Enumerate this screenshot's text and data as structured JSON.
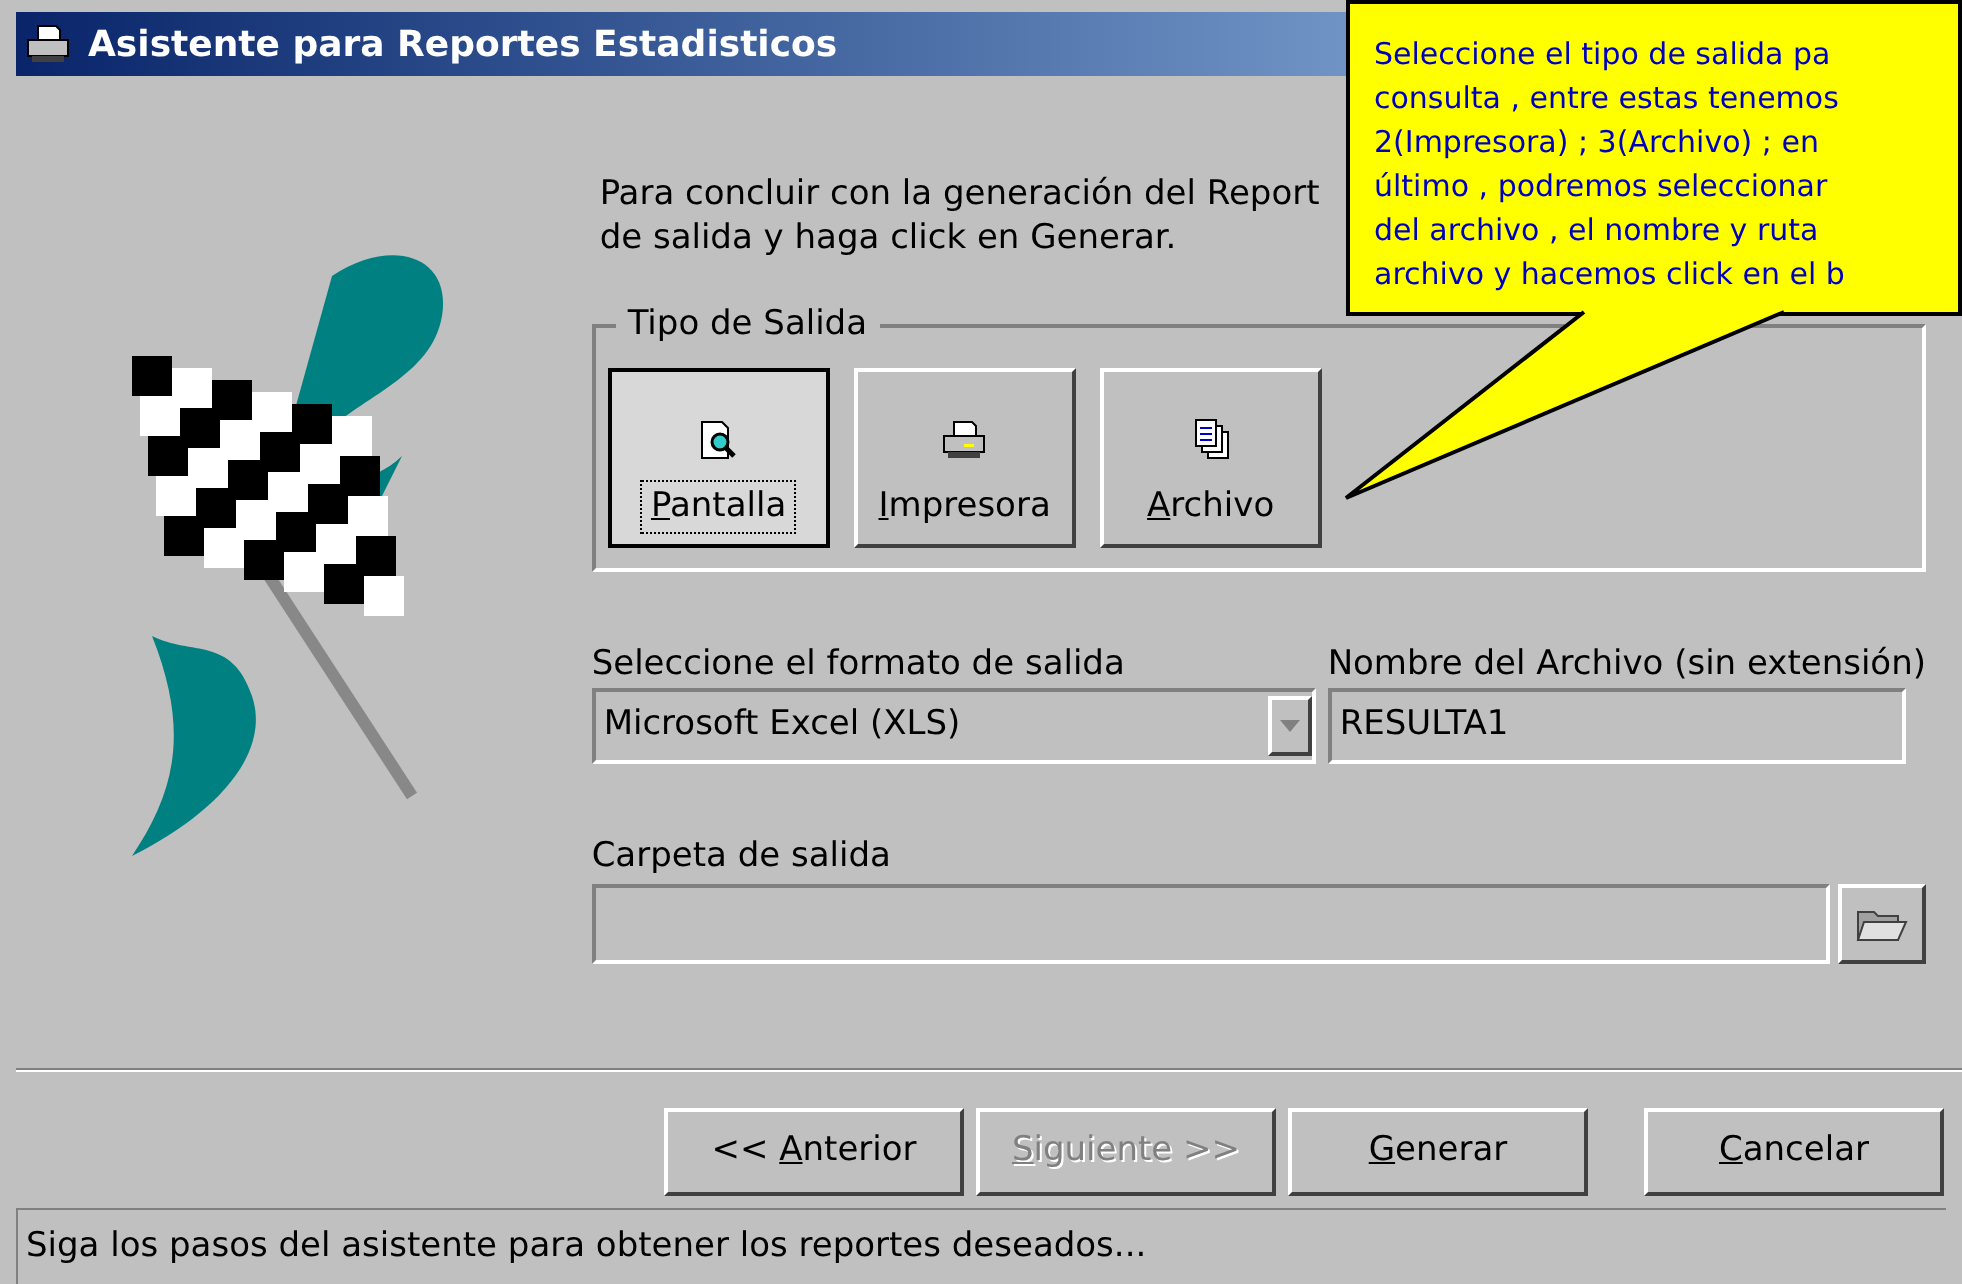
{
  "window": {
    "title": "Asistente para Reportes Estadisticos"
  },
  "intro": [
    "Para concluir con la generación del Report",
    "de salida y haga click en Generar."
  ],
  "output_type": {
    "title": "Tipo de Salida",
    "options": [
      {
        "label": {
          "key": "P",
          "after": "antalla"
        },
        "selected": true,
        "kind": "screen"
      },
      {
        "label": {
          "key": "I",
          "after": "mpresora"
        },
        "selected": false,
        "kind": "printer"
      },
      {
        "label": {
          "key": "A",
          "after": "rchivo"
        },
        "selected": false,
        "kind": "file"
      }
    ]
  },
  "format": {
    "label": "Seleccione el formato de salida",
    "value": "Microsoft Excel (XLS)"
  },
  "file_name": {
    "label": "Nombre del Archivo (sin extensión)",
    "value": "RESULTA1"
  },
  "folder": {
    "label": "Carpeta de salida"
  },
  "buttons": [
    {
      "label": {
        "before": "<< ",
        "key": "A",
        "after": "nterior"
      },
      "disabled": false
    },
    {
      "label": {
        "key": "S",
        "after": "iguiente >>"
      },
      "disabled": true
    },
    {
      "label": {
        "key": "G",
        "after": "enerar"
      },
      "disabled": false
    },
    {
      "label": {
        "key": "C",
        "after": "ancelar"
      },
      "disabled": false
    }
  ],
  "status_bar": "Siga los pasos del asistente para obtener los reportes deseados...",
  "callout": [
    "Seleccione el tipo de salida pa",
    "consulta , entre estas tenemos",
    "2(Impresora) ; 3(Archivo) ; en",
    "último , podremos seleccionar",
    "del archivo , el nombre y ruta",
    "archivo y hacemos click en el b"
  ]
}
